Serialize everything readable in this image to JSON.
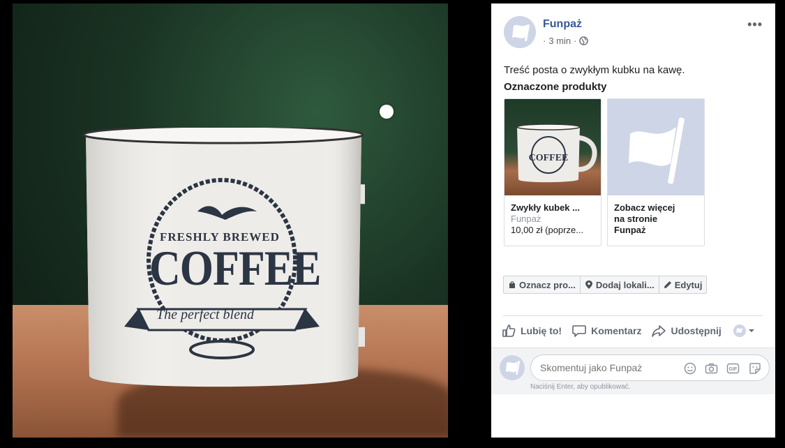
{
  "post": {
    "page_name": "Funpaż",
    "time": "3 min",
    "separator": "·",
    "visibility_icon": "globe-icon",
    "body_text": "Treść posta o zwykłym kubku na kawę.",
    "tagged_heading": "Oznaczone produkty"
  },
  "products": [
    {
      "title": "Zwykły kubek ...",
      "seller": "Funpaż",
      "price": "10,00 zł (poprze..."
    },
    {
      "see_more_line1": "Zobacz więcej",
      "see_more_line2": "na stronie",
      "see_more_line3": "Funpaż"
    }
  ],
  "actions": {
    "tag_products": "Oznacz pro...",
    "add_location": "Dodaj lokali...",
    "edit": "Edytuj"
  },
  "reactions": {
    "like": "Lubię to!",
    "comment": "Komentarz",
    "share": "Udostępnij"
  },
  "comment": {
    "placeholder": "Skomentuj jako Funpaż",
    "hint": "Naciśnij Enter, aby opublikować."
  },
  "mug": {
    "line1": "FRESHLY BREWED",
    "line2": "COFFEE",
    "line3": "The perfect blend"
  },
  "colors": {
    "link_blue": "#365899",
    "avatar_bg": "#ced5e6",
    "panel_bg": "#ffffff",
    "comment_bg": "#f2f3f5"
  }
}
